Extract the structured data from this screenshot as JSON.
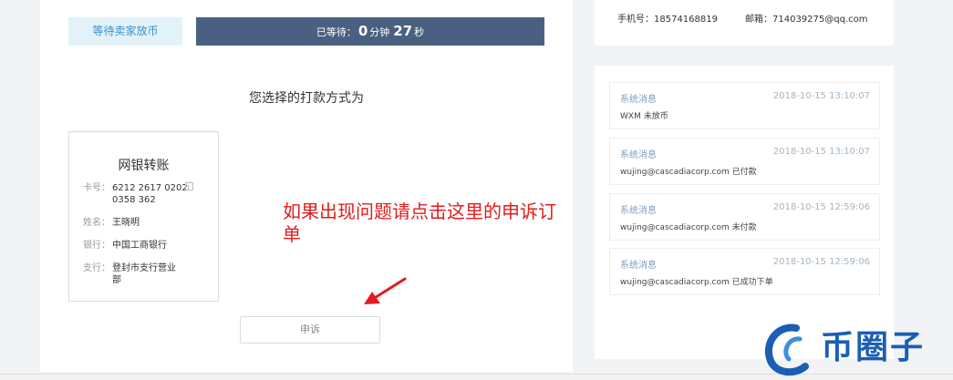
{
  "status": {
    "badge": "等待卖家放币",
    "timer_prefix": "已等待：",
    "timer_minutes": "0",
    "timer_min_unit": "分钟",
    "timer_seconds": "27",
    "timer_sec_unit": "秒"
  },
  "payment": {
    "heading": "您选择的打款方式为",
    "method": "网银转账",
    "card_label": "卡号：",
    "card_value": "6212 2617 0202 0358 362",
    "name_label": "姓名：",
    "name_value": "王晓明",
    "bank_label": "银行：",
    "bank_value": "中国工商银行",
    "branch_label": "支行：",
    "branch_value": "登封市支行营业部"
  },
  "annotation": "如果出现问题请点击这里的申诉订单",
  "appeal_label": "申诉",
  "contact": {
    "phone_label": "手机号：",
    "phone": "18574168819",
    "email_label": "邮箱：",
    "email": "714039275@qq.com"
  },
  "messages": [
    {
      "title": "系统消息",
      "date": "2018-10-15 13:10:07",
      "body": "WXM  未放币"
    },
    {
      "title": "系统消息",
      "date": "2018-10-15 13:10:07",
      "body": "wujing@cascadiacorp.com  已付款"
    },
    {
      "title": "系统消息",
      "date": "2018-10-15 12:59:06",
      "body": "wujing@cascadiacorp.com  未付款"
    },
    {
      "title": "系统消息",
      "date": "2018-10-15 12:59:06",
      "body": "wujing@cascadiacorp.com  已成功下单"
    }
  ],
  "watermark": "币圈子",
  "colors": {
    "accent_blue": "#3a8fc9",
    "timer_bg": "#4a6080",
    "annotation_red": "#e21b1b",
    "logo_blue": "#1a5fb4"
  }
}
